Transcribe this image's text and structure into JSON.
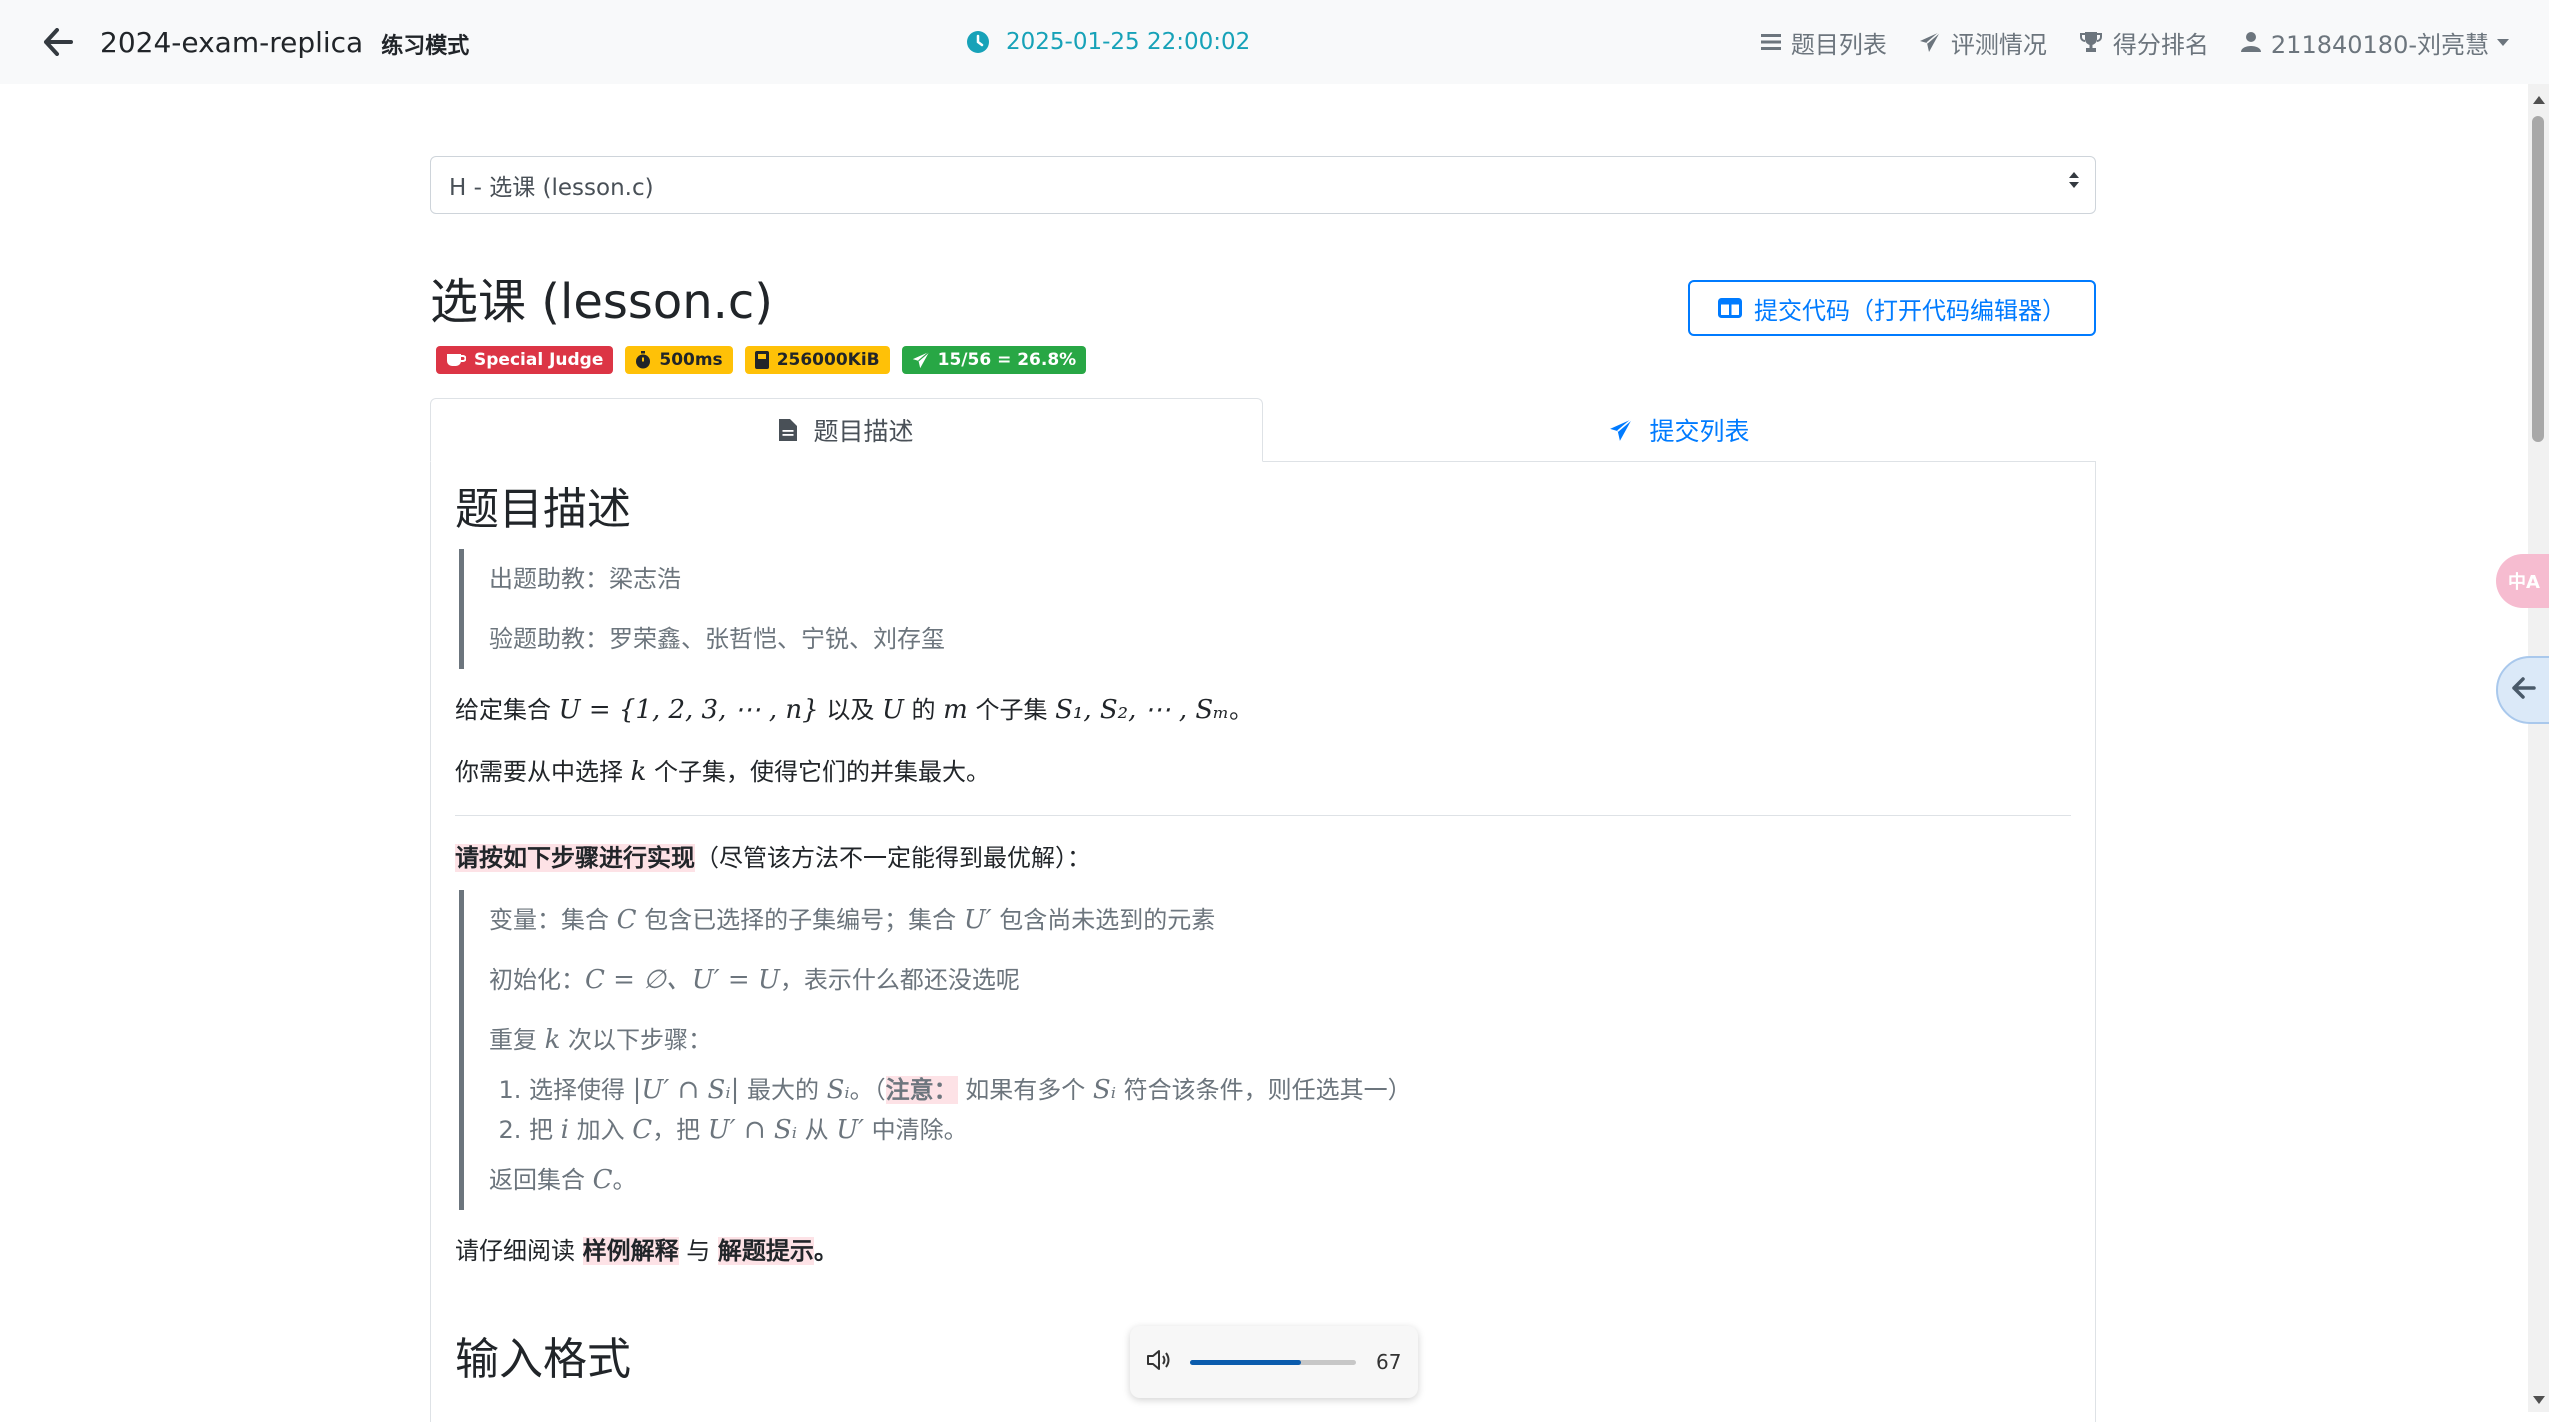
{
  "navbar": {
    "title": "2024-exam-replica",
    "mode": "练习模式",
    "time": "2025-01-25 22:00:02",
    "links": {
      "problems": "题目列表",
      "status": "评测情况",
      "ranking": "得分排名",
      "user": "211840180-刘亮慧"
    }
  },
  "problem_select": {
    "value": "H - 选课 (lesson.c)"
  },
  "problem": {
    "title": "选课 (lesson.c)",
    "submit_label": "提交代码（打开代码编辑器）",
    "badges": {
      "judge": "Special Judge",
      "time": "500ms",
      "memory": "256000KiB",
      "ratio": "15/56 = 26.8%"
    }
  },
  "tabs": {
    "description": "题目描述",
    "submissions": "提交列表"
  },
  "content": {
    "heading": "题目描述",
    "setter": "出题助教：梁志浩",
    "testers": "验题助教：罗荣鑫、张哲恺、宁锐、刘存玺",
    "p1": {
      "a": "给定集合 ",
      "u_math": "U = {1, 2, 3, ⋯ , n}",
      "b": " 以及 ",
      "u": "U",
      "c": " 的 ",
      "m": "m",
      "d": " 个子集 ",
      "subsets": "S₁, S₂, ⋯ , Sₘ",
      "e": "。"
    },
    "p2": {
      "a": "你需要从中选择 ",
      "k": "k",
      "b": " 个子集，使得它们的并集最大。"
    },
    "instruction": {
      "bold": "请按如下步骤进行实现",
      "rest": "（尽管该方法不一定能得到最优解）："
    },
    "algo": {
      "vars": {
        "a": "变量：集合 ",
        "c": "C",
        "b": " 包含已选择的子集编号；集合 ",
        "up": "U′",
        "d": " 包含尚未选到的元素"
      },
      "init": {
        "a": "初始化：",
        "math": "C = ∅、U′ = U",
        "b": "，表示什么都还没选呢"
      },
      "repeat": {
        "a": "重复 ",
        "k": "k",
        "b": " 次以下步骤："
      },
      "step1": {
        "a": "选择使得 ",
        "m1": "|U′ ∩ Sᵢ|",
        "b": " 最大的 ",
        "m2": "Sᵢ",
        "c": "。（",
        "note": "注意：",
        "d": " 如果有多个 ",
        "m3": "Sᵢ",
        "e": " 符合该条件，则任选其一）"
      },
      "step2": {
        "a": "把 ",
        "i": "i",
        "b": " 加入 ",
        "c": "C",
        "d": "，把 ",
        "m1": "U′ ∩ Sᵢ",
        "e": " 从 ",
        "up": "U′",
        "f": " 中清除。"
      },
      "ret": {
        "a": "返回集合 ",
        "c": "C",
        "b": "。"
      }
    },
    "read": {
      "a": "请仔细阅读 ",
      "link1": "样例解释",
      "b": " 与 ",
      "link2": "解题提示",
      "c": "。"
    },
    "input_heading": "输入格式"
  },
  "volume": {
    "value": "67",
    "level": 0.67
  },
  "side": {
    "translate": "中A"
  },
  "colors": {
    "primary": "#007bff",
    "info": "#17a2b8",
    "danger": "#dc3545",
    "warning": "#ffc107",
    "success": "#28a745",
    "muted": "#6c757d"
  }
}
